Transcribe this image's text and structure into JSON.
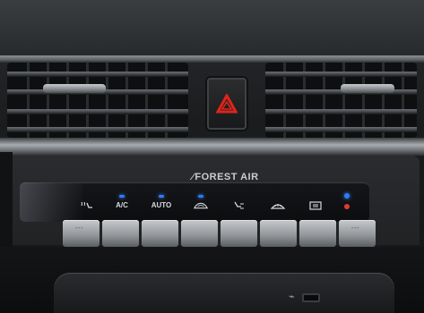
{
  "brand_text": "FOREST AIR",
  "hazard": {
    "icon": "hazard-triangle-icon",
    "color": "#e0241b"
  },
  "climate_controls": [
    {
      "id": "seat-heat",
      "icon": "seat-heat-icon",
      "label": "",
      "led": false
    },
    {
      "id": "ac",
      "icon": "",
      "label": "A/C",
      "led": true
    },
    {
      "id": "auto",
      "icon": "",
      "label": "AUTO",
      "led": true
    },
    {
      "id": "recirc",
      "icon": "recirculation-icon",
      "label": "",
      "led": true
    },
    {
      "id": "airflow",
      "icon": "airflow-mode-icon",
      "label": "",
      "led": false
    },
    {
      "id": "front-defrost",
      "icon": "front-defrost-icon",
      "label": "",
      "led": false
    },
    {
      "id": "rear-defrost",
      "icon": "rear-defrost-icon",
      "label": "",
      "led": false
    }
  ],
  "led_color": "#2f7bff",
  "usb_icon": "usb-icon"
}
